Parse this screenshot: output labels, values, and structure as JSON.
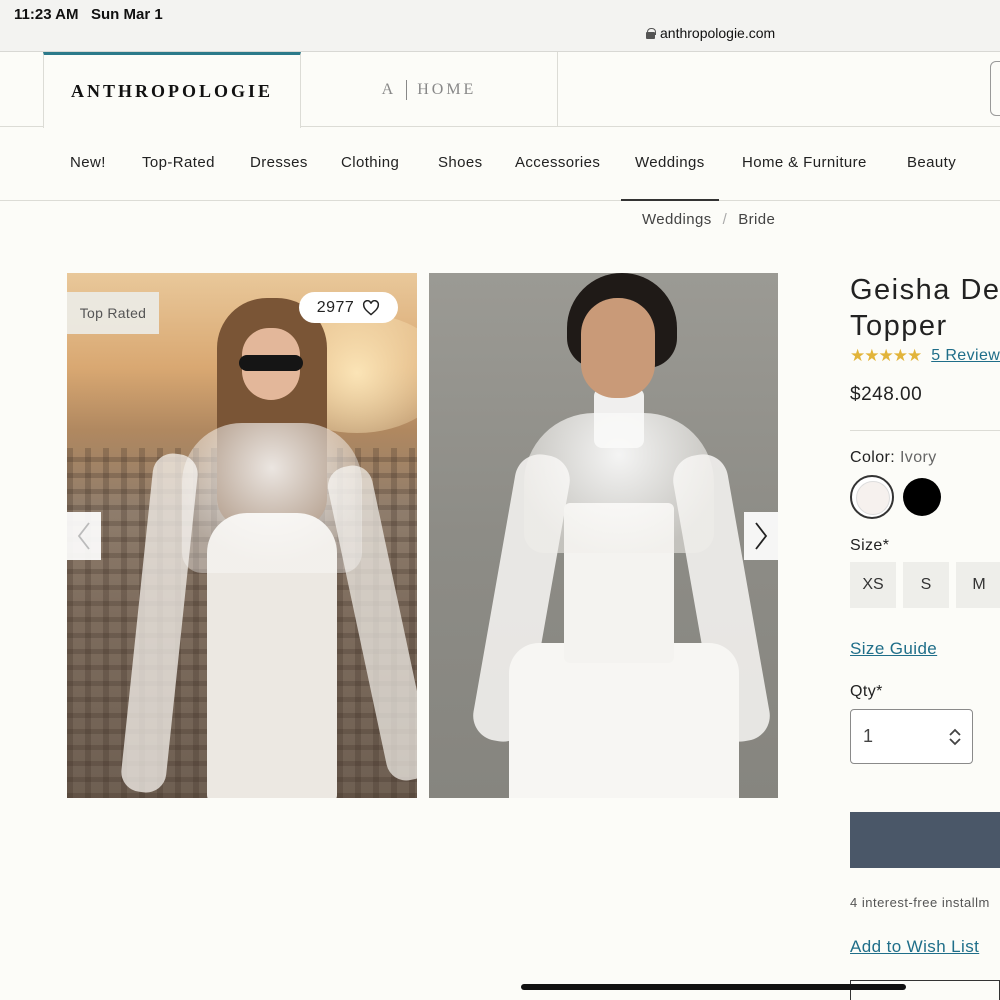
{
  "status_bar": {
    "time": "11:23 AM",
    "date": "Sun Mar 1",
    "url": "anthropologie.com"
  },
  "brand_tabs": {
    "anthropologie": "ANTHROPOLOGIE",
    "home_a": "A",
    "home_label": "HOME"
  },
  "nav": {
    "items": [
      "New!",
      "Top-Rated",
      "Dresses",
      "Clothing",
      "Shoes",
      "Accessories",
      "Weddings",
      "Home & Furniture",
      "Beauty"
    ],
    "active": "Weddings"
  },
  "breadcrumb": [
    "Weddings",
    "Bride"
  ],
  "gallery": {
    "badge": "Top Rated",
    "favorites_count": "2977",
    "icons": [
      "heart-icon",
      "chevron-left-icon",
      "chevron-right-icon"
    ]
  },
  "product": {
    "title_line1": "Geisha Des",
    "title_line2": "Topper",
    "rating_stars": 5,
    "stars_text": "★★★★★",
    "reviews_link": "5 Review",
    "price": "$248.00",
    "color_label": "Color:",
    "color_value": "Ivory",
    "colors": [
      {
        "name": "Ivory",
        "hex": "#f6f1ee",
        "selected": true
      },
      {
        "name": "Black",
        "hex": "#000000",
        "selected": false
      }
    ],
    "size_label": "Size*",
    "sizes": [
      "XS",
      "S",
      "M"
    ],
    "size_guide": "Size Guide",
    "qty_label": "Qty*",
    "qty_value": "1",
    "add_to_bag_color": "#4a5768",
    "installments": "4 interest-free installm",
    "wishlist": "Add to Wish List"
  },
  "colors": {
    "accent": "#2c7a8a",
    "link": "#1f6e89",
    "star": "#e2b43a"
  }
}
